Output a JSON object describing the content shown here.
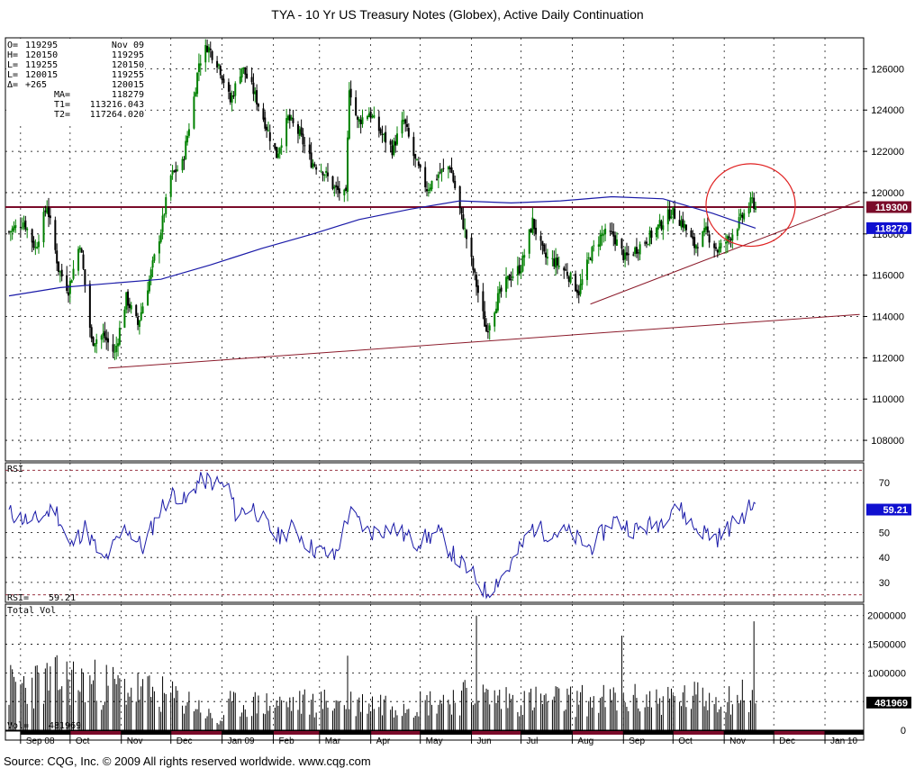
{
  "chart_data": {
    "type": "candlestick",
    "title": "TYA - 10 Yr US Treasury Notes (Globex), Active Daily Continuation",
    "source": "Source: CQG, Inc. © 2009 All rights reserved worldwide. www.cqg.com",
    "colors": {
      "up": "#008000",
      "down": "#000000",
      "ma": "#1a1aa8",
      "trendline": "#8b1a2a",
      "resistance": "#7a0b2a",
      "rsi": "#1a1aa8",
      "volume": "#000000",
      "circle": "#e02020",
      "grid": "#000000",
      "price_tag_bg": "#7a0b2a",
      "ma_tag_bg": "#1010d0",
      "rsi_tag_bg": "#1010d0",
      "vol_tag_bg": "#000000"
    },
    "date_range": [
      "2008-08-25",
      "2009-11-20"
    ],
    "months": [
      {
        "label": "Sep 08",
        "date": "2008-09-01"
      },
      {
        "label": "Oct",
        "date": "2008-10-01"
      },
      {
        "label": "Nov",
        "date": "2008-11-01"
      },
      {
        "label": "Dec",
        "date": "2008-12-01"
      },
      {
        "label": "Jan 09",
        "date": "2009-01-01"
      },
      {
        "label": "Feb",
        "date": "2009-02-01"
      },
      {
        "label": "Mar",
        "date": "2009-03-01"
      },
      {
        "label": "Apr",
        "date": "2009-04-01"
      },
      {
        "label": "May",
        "date": "2009-05-01"
      },
      {
        "label": "Jun",
        "date": "2009-06-01"
      },
      {
        "label": "Jul",
        "date": "2009-07-01"
      },
      {
        "label": "Aug",
        "date": "2009-08-01"
      },
      {
        "label": "Sep",
        "date": "2009-09-01"
      },
      {
        "label": "Oct",
        "date": "2009-10-01"
      },
      {
        "label": "Nov",
        "date": "2009-11-01"
      },
      {
        "label": "Dec",
        "date": "2009-12-01"
      },
      {
        "label": "Jan 10",
        "date": "2010-01-01"
      }
    ],
    "price_panel": {
      "ylim": [
        107000,
        127500
      ],
      "ticks": [
        {
          "value": 108000,
          "label": "108000"
        },
        {
          "value": 110000,
          "label": "110000"
        },
        {
          "value": 112000,
          "label": "112000"
        },
        {
          "value": 114000,
          "label": "114000"
        },
        {
          "value": 116000,
          "label": "116000"
        },
        {
          "value": 118000,
          "label": "118000"
        },
        {
          "value": 120000,
          "label": "120000"
        },
        {
          "value": 122000,
          "label": "122000"
        },
        {
          "value": 124000,
          "label": "124000"
        },
        {
          "value": 126000,
          "label": "126000"
        }
      ],
      "info_box": [
        [
          "O=",
          "119295",
          "Nov 09"
        ],
        [
          "H=",
          "120150",
          "119295"
        ],
        [
          "L=",
          "119255",
          "120150"
        ],
        [
          "L=",
          "120015",
          "119255"
        ],
        [
          "Δ=",
          "+265",
          "120015"
        ],
        [
          "",
          "MA=",
          "118279"
        ],
        [
          "",
          "T1=",
          "113216.043"
        ],
        [
          "",
          "T2=",
          "117264.020"
        ]
      ],
      "last_price_label": "119300",
      "last_price": 119300,
      "ma_label": "118279",
      "ma_value": 118279,
      "resistance_level": 119300,
      "close_path": [
        [
          "2008-08-25",
          118100
        ],
        [
          "2008-09-03",
          118600
        ],
        [
          "2008-09-10",
          117300
        ],
        [
          "2008-09-17",
          119400
        ],
        [
          "2008-09-24",
          116300
        ],
        [
          "2008-09-30",
          115300
        ],
        [
          "2008-10-07",
          117600
        ],
        [
          "2008-10-14",
          112800
        ],
        [
          "2008-10-21",
          113100
        ],
        [
          "2008-10-28",
          112200
        ],
        [
          "2008-11-04",
          114900
        ],
        [
          "2008-11-11",
          113600
        ],
        [
          "2008-11-18",
          115800
        ],
        [
          "2008-11-25",
          118200
        ],
        [
          "2008-12-01",
          120800
        ],
        [
          "2008-12-08",
          121400
        ],
        [
          "2008-12-15",
          124600
        ],
        [
          "2008-12-18",
          126300
        ],
        [
          "2008-12-23",
          127100
        ],
        [
          "2008-12-30",
          126200
        ],
        [
          "2009-01-06",
          124400
        ],
        [
          "2009-01-13",
          126100
        ],
        [
          "2009-01-20",
          124900
        ],
        [
          "2009-01-27",
          123400
        ],
        [
          "2009-02-03",
          121800
        ],
        [
          "2009-02-10",
          123600
        ],
        [
          "2009-02-17",
          122800
        ],
        [
          "2009-02-24",
          121500
        ],
        [
          "2009-03-03",
          121100
        ],
        [
          "2009-03-10",
          120200
        ],
        [
          "2009-03-17",
          119800
        ],
        [
          "2009-03-19",
          125200
        ],
        [
          "2009-03-24",
          123400
        ],
        [
          "2009-03-31",
          123900
        ],
        [
          "2009-04-07",
          122900
        ],
        [
          "2009-04-14",
          122100
        ],
        [
          "2009-04-21",
          123500
        ],
        [
          "2009-04-28",
          121500
        ],
        [
          "2009-05-05",
          120200
        ],
        [
          "2009-05-12",
          120900
        ],
        [
          "2009-05-19",
          121300
        ],
        [
          "2009-05-26",
          118800
        ],
        [
          "2009-05-29",
          117800
        ],
        [
          "2009-06-03",
          115900
        ],
        [
          "2009-06-10",
          113300
        ],
        [
          "2009-06-17",
          114900
        ],
        [
          "2009-06-24",
          115900
        ],
        [
          "2009-07-01",
          116400
        ],
        [
          "2009-07-08",
          118600
        ],
        [
          "2009-07-15",
          116900
        ],
        [
          "2009-07-22",
          116600
        ],
        [
          "2009-07-29",
          116100
        ],
        [
          "2009-08-05",
          115200
        ],
        [
          "2009-08-12",
          117000
        ],
        [
          "2009-08-19",
          118000
        ],
        [
          "2009-08-26",
          117900
        ],
        [
          "2009-09-02",
          116800
        ],
        [
          "2009-09-09",
          117300
        ],
        [
          "2009-09-16",
          117800
        ],
        [
          "2009-09-23",
          118400
        ],
        [
          "2009-09-30",
          119100
        ],
        [
          "2009-10-07",
          118500
        ],
        [
          "2009-10-14",
          117400
        ],
        [
          "2009-10-21",
          118100
        ],
        [
          "2009-10-28",
          117200
        ],
        [
          "2009-11-04",
          117800
        ],
        [
          "2009-11-11",
          118700
        ],
        [
          "2009-11-18",
          119600
        ],
        [
          "2009-11-20",
          119300
        ]
      ],
      "ma_path": [
        [
          "2008-08-25",
          115000
        ],
        [
          "2008-09-25",
          115400
        ],
        [
          "2008-10-25",
          115600
        ],
        [
          "2008-11-25",
          115800
        ],
        [
          "2008-12-25",
          116500
        ],
        [
          "2009-01-25",
          117300
        ],
        [
          "2009-02-25",
          118000
        ],
        [
          "2009-03-25",
          118700
        ],
        [
          "2009-04-25",
          119200
        ],
        [
          "2009-05-25",
          119600
        ],
        [
          "2009-06-25",
          119500
        ],
        [
          "2009-07-25",
          119600
        ],
        [
          "2009-08-25",
          119800
        ],
        [
          "2009-09-25",
          119700
        ],
        [
          "2009-10-25",
          119000
        ],
        [
          "2009-11-20",
          118279
        ]
      ],
      "trendlines": [
        {
          "from": [
            "2008-10-24",
            111500
          ],
          "to": [
            "2010-01-22",
            114100
          ]
        },
        {
          "from": [
            "2009-08-12",
            114600
          ],
          "to": [
            "2010-01-22",
            119600
          ]
        }
      ],
      "highlight_circle": {
        "center": [
          "2009-11-17",
          119400
        ],
        "radius_x_days": 27,
        "radius_y_value": 2000
      }
    },
    "rsi_panel": {
      "label": "RSI",
      "value_label": "RSI=",
      "value": 59.21,
      "value_text": "59.21",
      "ylim": [
        22,
        78
      ],
      "ticks": [
        {
          "value": 30,
          "label": "30"
        },
        {
          "value": 40,
          "label": "40"
        },
        {
          "value": 50,
          "label": "50"
        },
        {
          "value": 70,
          "label": "70"
        }
      ],
      "dashed_levels": [
        75,
        25
      ],
      "path": [
        [
          "2008-08-25",
          58
        ],
        [
          "2008-09-08",
          54
        ],
        [
          "2008-09-22",
          60
        ],
        [
          "2008-10-01",
          44
        ],
        [
          "2008-10-10",
          52
        ],
        [
          "2008-10-21",
          38
        ],
        [
          "2008-11-04",
          52
        ],
        [
          "2008-11-14",
          44
        ],
        [
          "2008-11-25",
          60
        ],
        [
          "2008-12-03",
          66
        ],
        [
          "2008-12-10",
          62
        ],
        [
          "2008-12-17",
          70
        ],
        [
          "2008-12-23",
          71
        ],
        [
          "2009-01-05",
          68
        ],
        [
          "2009-01-09",
          58
        ],
        [
          "2009-01-20",
          60
        ],
        [
          "2009-02-03",
          48
        ],
        [
          "2009-02-13",
          52
        ],
        [
          "2009-02-24",
          44
        ],
        [
          "2009-03-10",
          40
        ],
        [
          "2009-03-19",
          58
        ],
        [
          "2009-03-31",
          50
        ],
        [
          "2009-04-14",
          52
        ],
        [
          "2009-04-28",
          46
        ],
        [
          "2009-05-12",
          50
        ],
        [
          "2009-05-22",
          40
        ],
        [
          "2009-06-03",
          32
        ],
        [
          "2009-06-10",
          26
        ],
        [
          "2009-06-24",
          36
        ],
        [
          "2009-07-08",
          52
        ],
        [
          "2009-07-17",
          50
        ],
        [
          "2009-07-29",
          50
        ],
        [
          "2009-08-12",
          44
        ],
        [
          "2009-08-26",
          55
        ],
        [
          "2009-09-09",
          51
        ],
        [
          "2009-09-23",
          54
        ],
        [
          "2009-10-02",
          62
        ],
        [
          "2009-10-14",
          52
        ],
        [
          "2009-10-28",
          48
        ],
        [
          "2009-11-11",
          56
        ],
        [
          "2009-11-18",
          61
        ],
        [
          "2009-11-20",
          59
        ]
      ]
    },
    "volume_panel": {
      "label": "Total Vol",
      "value_label": "Vol=",
      "value": 481969,
      "value_text": "481969",
      "ylim": [
        0,
        2200000
      ],
      "ticks": [
        {
          "value": 0,
          "label": "0"
        },
        {
          "value": 500000,
          "label": "500000"
        },
        {
          "value": 1000000,
          "label": "1000000"
        },
        {
          "value": 1500000,
          "label": "1500000"
        },
        {
          "value": 2000000,
          "label": "2000000"
        }
      ],
      "profile": [
        [
          "2008-08-25",
          950000
        ],
        [
          "2008-10-01",
          1100000
        ],
        [
          "2008-11-15",
          850000
        ],
        [
          "2008-12-15",
          600000
        ],
        [
          "2008-12-30",
          150000
        ],
        [
          "2009-01-06",
          550000
        ],
        [
          "2009-03-01",
          600000
        ],
        [
          "2009-05-01",
          600000
        ],
        [
          "2009-06-01",
          750000
        ],
        [
          "2009-07-01",
          650000
        ],
        [
          "2009-09-01",
          650000
        ],
        [
          "2009-11-20",
          750000
        ]
      ],
      "spikes": [
        [
          "2009-03-18",
          1300000
        ],
        [
          "2009-06-04",
          2000000
        ],
        [
          "2009-08-31",
          1650000
        ],
        [
          "2009-11-19",
          1900000
        ]
      ]
    }
  }
}
